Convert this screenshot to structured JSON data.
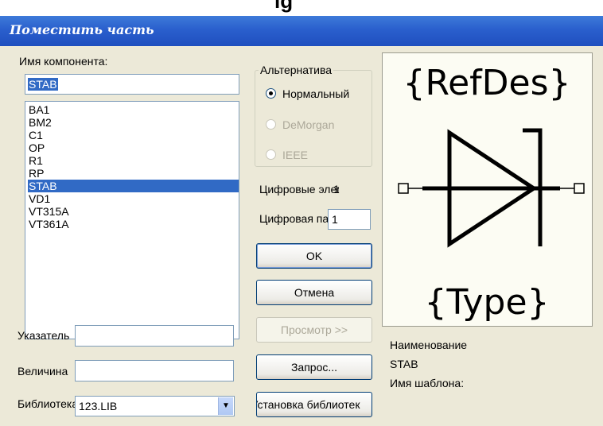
{
  "window": {
    "title": "Поместить часть",
    "top_glyph": "ig"
  },
  "component_name": {
    "label": "Имя компонента:",
    "value": "STAB"
  },
  "components": [
    "BA1",
    "BM2",
    "C1",
    "OP",
    "R1",
    "RP",
    "STAB",
    "VD1",
    "VT315A",
    "VT361A"
  ],
  "selected_index": 6,
  "alternative": {
    "legend": "Альтернатива",
    "options": [
      {
        "label": "Нормальный",
        "checked": true,
        "enabled": true
      },
      {
        "label": "DeMorgan",
        "checked": false,
        "enabled": false
      },
      {
        "label": "IEEE",
        "checked": false,
        "enabled": false
      }
    ]
  },
  "digital_elements": {
    "label": "Цифровые элементы",
    "value": "1"
  },
  "digital_panel": {
    "label": "Цифровая панель:",
    "value": "1"
  },
  "buttons": {
    "ok": "OK",
    "cancel": "Отмена",
    "browse": "Просмотр >>",
    "query": "Запрос...",
    "library_setup": "Установка библиотек"
  },
  "pointer_field": {
    "label": "Указатель",
    "value": ""
  },
  "value_field": {
    "label": "Величина",
    "value": ""
  },
  "library": {
    "label": "Библиотека",
    "value": "123.LIB"
  },
  "preview": {
    "refdes": "{RefDes}",
    "type": "{Type}"
  },
  "info": {
    "name_label": "Наименование",
    "name_value": "STAB",
    "template_label": "Имя шаблона:"
  },
  "colors": {
    "titlebar": "#2a5fcd",
    "selection": "#316ac5",
    "dialog": "#ece9d8"
  }
}
